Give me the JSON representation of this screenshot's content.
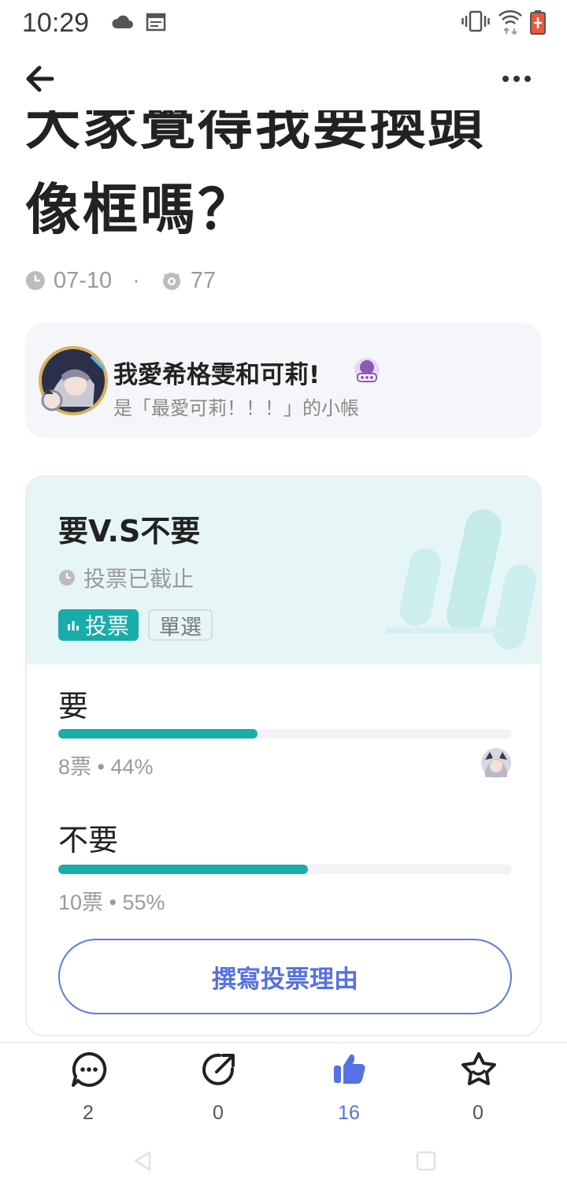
{
  "status_bar": {
    "time": "10:29",
    "icons": [
      "cloud-icon",
      "calendar-icon",
      "vibrate-icon",
      "wifi-icon",
      "battery-icon"
    ]
  },
  "header": {
    "back_icon": "back-arrow-icon",
    "more_icon": "more-dots-icon"
  },
  "post": {
    "title": "大家覺得我要換頭像框嗎？",
    "date": "07-10",
    "separator": "·",
    "views": "77"
  },
  "author": {
    "name": "我愛希格雯和可莉!",
    "subtitle": "是「最愛可莉！！！」的小帳"
  },
  "poll": {
    "title": "要V.S不要",
    "status": "投票已截止",
    "tag_vote": "投票",
    "tag_single": "單選",
    "options": [
      {
        "label": "要",
        "votes_text": "8票 • 44%",
        "percent": 44
      },
      {
        "label": "不要",
        "votes_text": "10票 • 55%",
        "percent": 55
      }
    ],
    "write_reason": "撰寫投票理由"
  },
  "actions": [
    {
      "name": "comment",
      "count": "2"
    },
    {
      "name": "share",
      "count": "0"
    },
    {
      "name": "like",
      "count": "16"
    },
    {
      "name": "favorite",
      "count": "0"
    }
  ],
  "colors": {
    "accent_teal": "#18acaa",
    "accent_blue": "#5571e4",
    "poll_header_bg": "#e6f6f6"
  }
}
